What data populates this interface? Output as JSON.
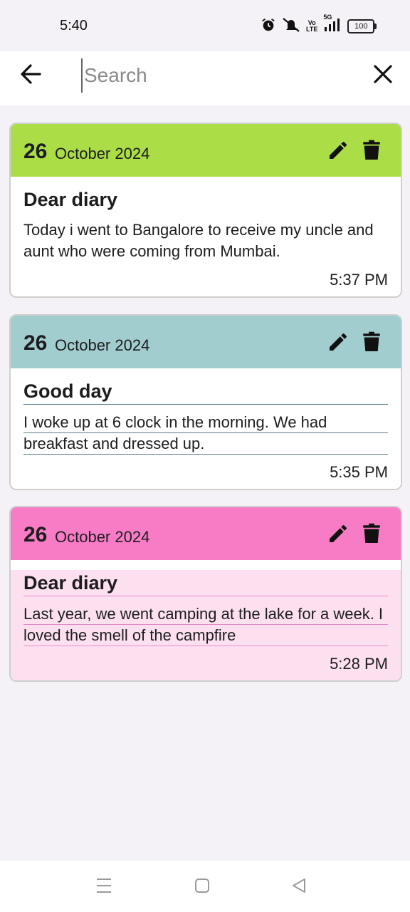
{
  "status": {
    "time": "5:40",
    "volte": [
      "Vo",
      "LTE"
    ],
    "network": "5G",
    "battery": "100"
  },
  "search": {
    "placeholder": "Search",
    "value": ""
  },
  "entries": [
    {
      "day": "26",
      "month_year": "October 2024",
      "title": "Dear diary",
      "text": "Today i went to Bangalore to receive my uncle and aunt who were coming from Mumbai.",
      "time": "5:37 PM",
      "header_color": "#abdd47",
      "body_color": "#ffffff",
      "line_color": null
    },
    {
      "day": "26",
      "month_year": "October 2024",
      "title": "Good day",
      "text": "I woke up at 6 clock in the morning. We had breakfast and dressed up.",
      "time": "5:35 PM",
      "header_color": "#a2cdcf",
      "body_color": "#ffffff",
      "line_color": "#5a7a86"
    },
    {
      "day": "26",
      "month_year": "October 2024",
      "title": "Dear diary",
      "text": "Last year, we went camping at the lake for a week. I loved the smell of the campfire",
      "time": "5:28 PM",
      "header_color": "#f77cc5",
      "body_color": "#fde0f0",
      "line_color": "#e58ac8"
    }
  ],
  "icons": {
    "back": "arrow-left-icon",
    "close": "close-icon",
    "edit": "pencil-icon",
    "delete": "trash-icon"
  }
}
